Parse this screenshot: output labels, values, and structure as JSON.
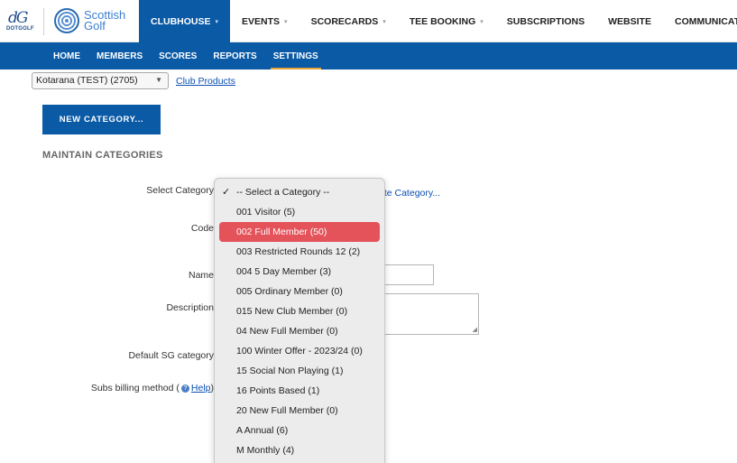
{
  "logos": {
    "dotgolf_text": "DOTGOLF",
    "scottish_golf_line1": "Scottish",
    "scottish_golf_line2": "Golf"
  },
  "main_nav": [
    {
      "label": "CLUBHOUSE",
      "caret": true,
      "active": true
    },
    {
      "label": "EVENTS",
      "caret": true,
      "active": false
    },
    {
      "label": "SCORECARDS",
      "caret": true,
      "active": false
    },
    {
      "label": "TEE BOOKING",
      "caret": true,
      "active": false
    },
    {
      "label": "SUBSCRIPTIONS",
      "caret": false,
      "active": false
    },
    {
      "label": "WEBSITE",
      "caret": false,
      "active": false
    },
    {
      "label": "COMMUNICATIONS",
      "caret": true,
      "active": false
    }
  ],
  "sub_nav": [
    {
      "label": "HOME",
      "active": false
    },
    {
      "label": "MEMBERS",
      "active": false
    },
    {
      "label": "SCORES",
      "active": false
    },
    {
      "label": "REPORTS",
      "active": false
    },
    {
      "label": "SETTINGS",
      "active": true
    }
  ],
  "club_selector": {
    "value": "Kotarana (TEST) (2705)"
  },
  "club_products_link": "Club Products",
  "new_category_button": "NEW CATEGORY...",
  "section_title": "MAINTAIN CATEGORIES",
  "form": {
    "select_category_label": "Select Category",
    "code_label": "Code",
    "name_label": "Name",
    "description_label": "Description",
    "default_sg_label": "Default SG category",
    "subs_billing_prefix": "Subs billing method (",
    "subs_billing_help": "Help",
    "subs_billing_suffix": ")",
    "delete_link": "ete Category..."
  },
  "dropdown": {
    "options": [
      {
        "label": "-- Select a Category --",
        "checked": true,
        "highlighted": false
      },
      {
        "label": "001 Visitor (5)",
        "checked": false,
        "highlighted": false
      },
      {
        "label": "002 Full Member (50)",
        "checked": false,
        "highlighted": true
      },
      {
        "label": "003 Restricted Rounds 12 (2)",
        "checked": false,
        "highlighted": false
      },
      {
        "label": "004 5 Day Member (3)",
        "checked": false,
        "highlighted": false
      },
      {
        "label": "005 Ordinary Member (0)",
        "checked": false,
        "highlighted": false
      },
      {
        "label": "015 New Club Member (0)",
        "checked": false,
        "highlighted": false
      },
      {
        "label": "04 New Full Member (0)",
        "checked": false,
        "highlighted": false
      },
      {
        "label": "100 Winter Offer - 2023/24 (0)",
        "checked": false,
        "highlighted": false
      },
      {
        "label": "15 Social Non Playing (1)",
        "checked": false,
        "highlighted": false
      },
      {
        "label": "16 Points Based (1)",
        "checked": false,
        "highlighted": false
      },
      {
        "label": "20 New Full Member (0)",
        "checked": false,
        "highlighted": false
      },
      {
        "label": "A Annual (6)",
        "checked": false,
        "highlighted": false
      },
      {
        "label": "M Monthly (4)",
        "checked": false,
        "highlighted": false
      }
    ]
  },
  "colors": {
    "brand_blue": "#0a5aa6",
    "highlight_red": "#e4525a",
    "settings_underline": "#e8a33a"
  }
}
